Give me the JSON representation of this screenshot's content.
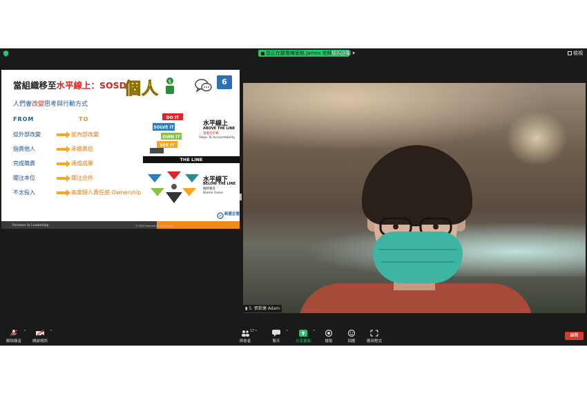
{
  "topbar": {
    "share_banner": "您正在觀看陳家銘 James 老師的螢幕",
    "view_options": "檢視選項",
    "gallery_label": "檢視"
  },
  "slide": {
    "title_prefix": "當組織移至",
    "title_red": "水平線上",
    "title_suffix": "：SOSD",
    "ge_ren": "個人",
    "badge": "6",
    "subtitle_prefix": "人們會",
    "subtitle_red": "改變",
    "subtitle_suffix": "思考與行動方式",
    "col_from": "FROM",
    "col_to": "TO",
    "rows": [
      {
        "from": "從外部改變",
        "to": "從內部改變"
      },
      {
        "from": "指責他人",
        "to": "承擔責任"
      },
      {
        "from": "完成職責",
        "to": "達成成果"
      },
      {
        "from": "關注本位",
        "to": "關注合作"
      },
      {
        "from": "不太投入",
        "to": "高度個人責任感 Ownership"
      }
    ],
    "steps": [
      "DO IT",
      "SOLVE IT",
      "OWN IT",
      "SEE IT"
    ],
    "above_title": "水平線上",
    "above_sub": "ABOVE THE LINE",
    "above_cn": "當責的步驟",
    "above_en": "Steps To Accountability",
    "the_line": "THE LINE",
    "below_title": "水平線下",
    "below_sub": "BELOW THE LINE",
    "below_cn": "推卸責任",
    "below_en": "Blame Game",
    "logo_text": "新盛企管",
    "footer_left": "Partners In Leadership",
    "footer_mid": "© 2019 Partners In Leadership"
  },
  "video": {
    "name_tag": "5. 張欽塘 Adam"
  },
  "toolbar": {
    "mute": "解除靜音",
    "video": "開啟視訊",
    "participants": "與會者",
    "participants_count": "17",
    "chat": "聊天",
    "share": "分享畫面",
    "record": "錄製",
    "reactions": "回應",
    "apps": "應用程式",
    "leave": "離開"
  },
  "colors": {
    "accent_green": "#23c66c",
    "leave_red": "#d23a32",
    "window_bg": "#1a1a1a"
  }
}
